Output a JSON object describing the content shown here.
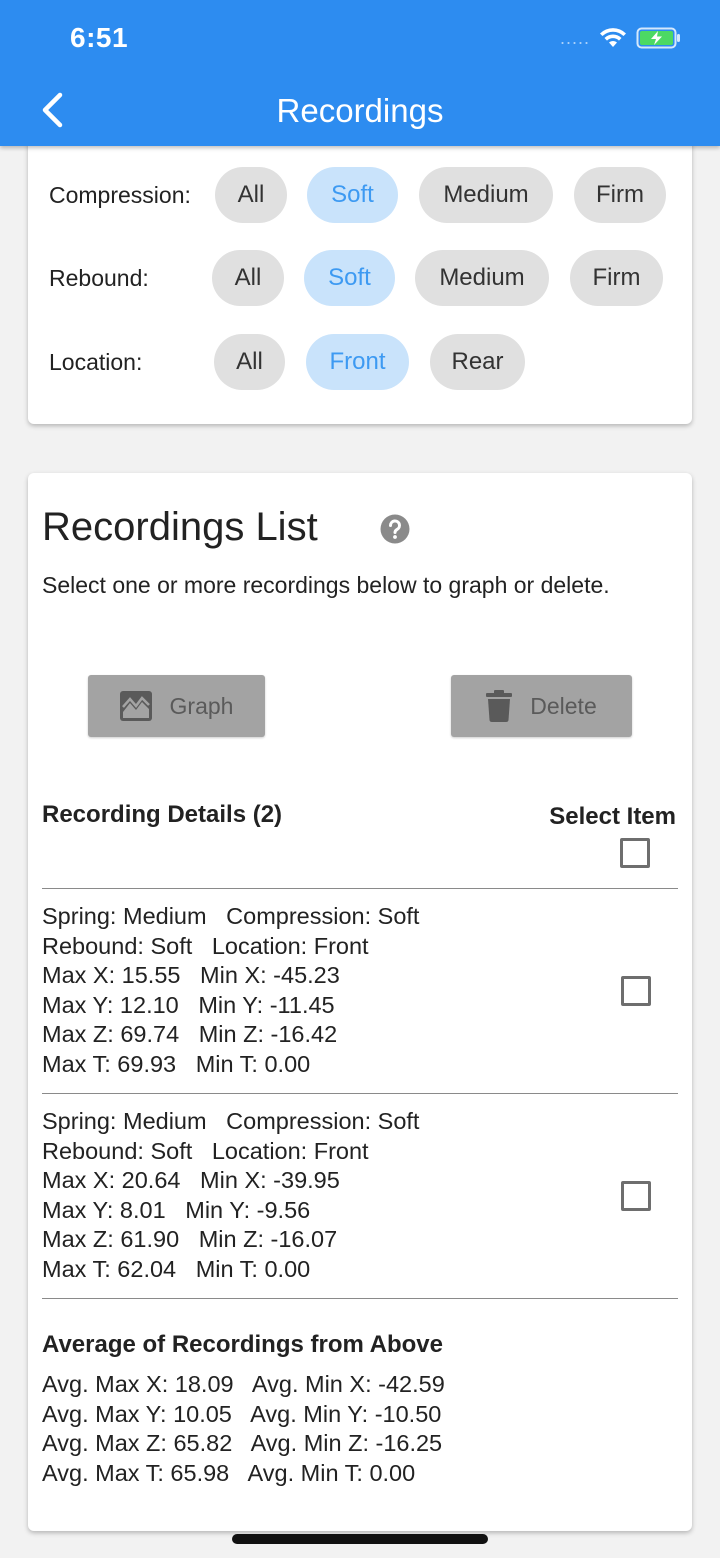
{
  "status": {
    "time": "6:51",
    "signal": "....."
  },
  "appbar": {
    "title": "Recordings"
  },
  "filters": {
    "compression": {
      "label": "Compression:",
      "options": [
        "All",
        "Soft",
        "Medium",
        "Firm"
      ],
      "selected": "Soft"
    },
    "rebound": {
      "label": "Rebound:",
      "options": [
        "All",
        "Soft",
        "Medium",
        "Firm"
      ],
      "selected": "Soft"
    },
    "location": {
      "label": "Location:",
      "options": [
        "All",
        "Front",
        "Rear"
      ],
      "selected": "Front"
    }
  },
  "list": {
    "title": "Recordings List",
    "description": "Select one or more recordings below to graph or delete.",
    "graph_label": "Graph",
    "delete_label": "Delete",
    "details_header": "Recording Details (2)",
    "select_header": "Select Item",
    "recordings": [
      {
        "lines": [
          "Spring: Medium   Compression: Soft",
          "Rebound: Soft   Location: Front",
          "Max X: 15.55   Min X: -45.23",
          "Max Y: 12.10   Min Y: -11.45",
          "Max Z: 69.74   Min Z: -16.42",
          "Max T: 69.93   Min T: 0.00"
        ]
      },
      {
        "lines": [
          "Spring: Medium   Compression: Soft",
          "Rebound: Soft   Location: Front",
          "Max X: 20.64   Min X: -39.95",
          "Max Y: 8.01   Min Y: -9.56",
          "Max Z: 61.90   Min Z: -16.07",
          "Max T: 62.04   Min T: 0.00"
        ]
      }
    ],
    "average": {
      "title": "Average of Recordings from Above",
      "lines": [
        "Avg. Max X: 18.09   Avg. Min X: -42.59",
        "Avg. Max Y: 10.05   Avg. Min Y: -10.50",
        "Avg. Max Z: 65.82   Avg. Min Z: -16.25",
        "Avg. Max T: 65.98   Avg. Min T: 0.00"
      ]
    }
  },
  "colors": {
    "appbar": "#2d8cf0",
    "chip_selected_bg": "#c9e3fb",
    "chip_selected_text": "#3d9af2",
    "chip_bg": "#e0e0e0",
    "button_disabled": "#a3a3a3"
  }
}
